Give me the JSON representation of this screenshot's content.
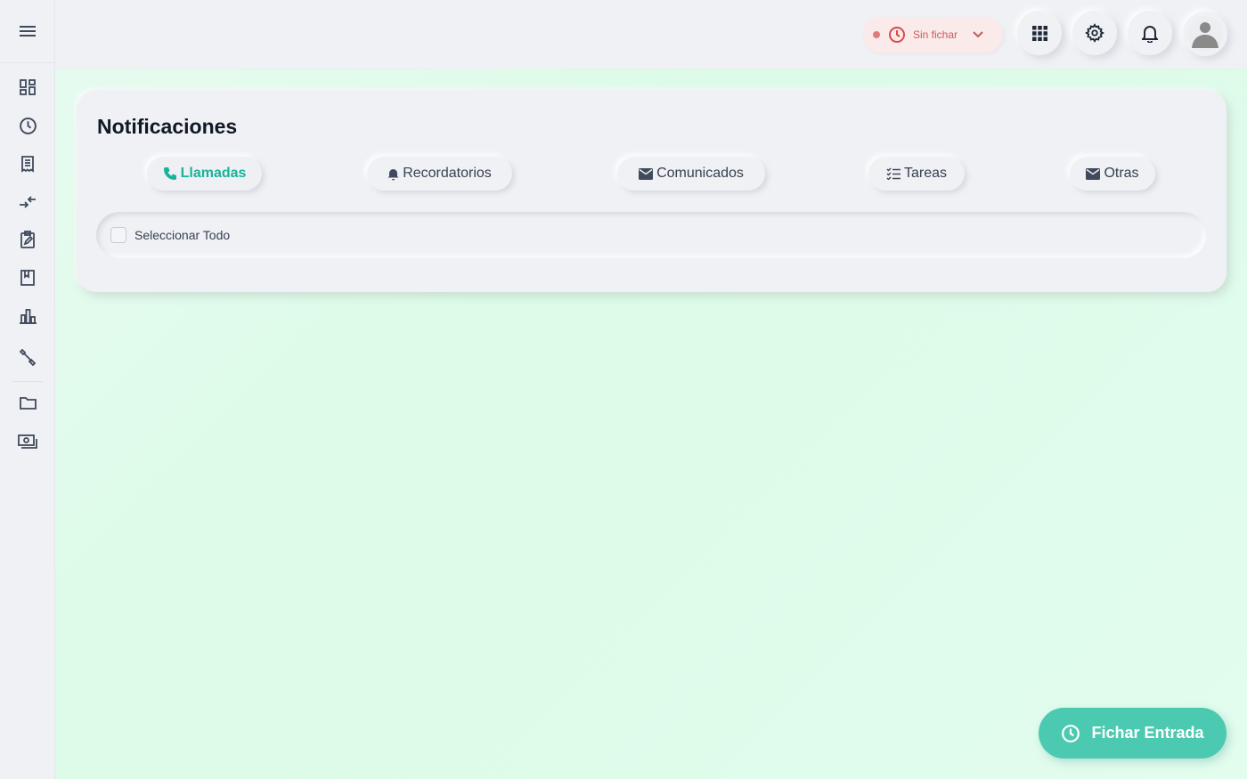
{
  "header": {
    "status": {
      "label": "Sin fichar",
      "color": "#c95a5a"
    },
    "icons": [
      "apps-grid-icon",
      "gear-icon",
      "bell-icon",
      "avatar"
    ]
  },
  "sidebar": {
    "items": [
      "dashboard-icon",
      "clock-icon",
      "receipt-icon",
      "transfer-icon",
      "clipboard-edit-icon",
      "book-icon",
      "bar-chart-icon",
      "wrench-icon",
      "folder-icon",
      "money-icon"
    ]
  },
  "main": {
    "title": "Notificaciones",
    "tabs": [
      {
        "label": "Llamadas",
        "icon": "phone-icon",
        "active": true
      },
      {
        "label": "Recordatorios",
        "icon": "bell-icon"
      },
      {
        "label": "Comunicados",
        "icon": "envelope-icon"
      },
      {
        "label": "Tareas",
        "icon": "checklist-icon"
      },
      {
        "label": "Otras",
        "icon": "envelope-icon"
      }
    ],
    "select_all_label": "Seleccionar Todo"
  },
  "fab": {
    "label": "Fichar Entrada",
    "color": "#4cc9b1"
  },
  "colors": {
    "accent": "#18b39a",
    "icon": "#3f4a5c"
  }
}
